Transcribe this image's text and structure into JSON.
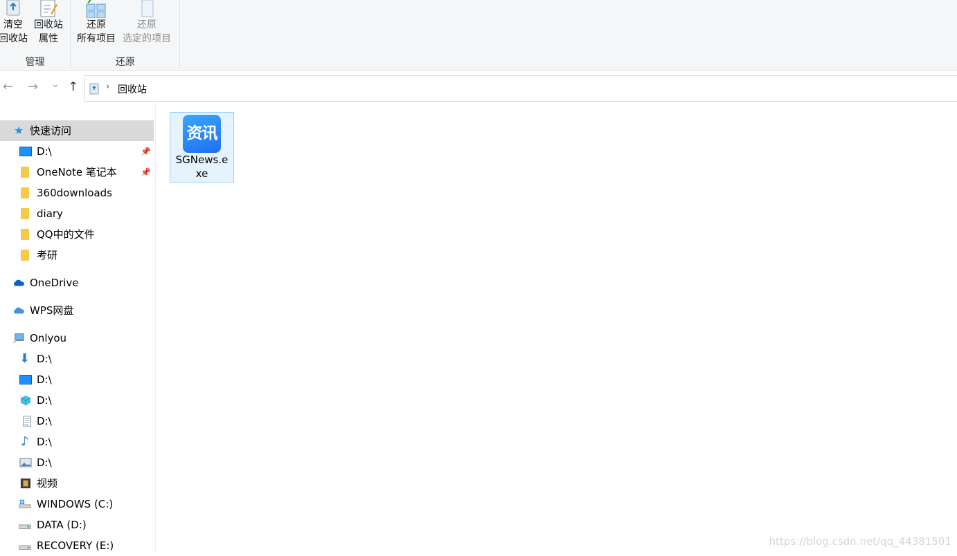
{
  "ribbon": {
    "groups": [
      {
        "label": "管理",
        "buttons": [
          {
            "line1": "清空",
            "line2": "回收站",
            "icon": "recycle-bin-empty-icon"
          },
          {
            "line1": "回收站",
            "line2": "属性",
            "icon": "properties-icon"
          }
        ]
      },
      {
        "label": "还原",
        "buttons": [
          {
            "line1": "还原",
            "line2": "所有项目",
            "icon": "restore-all-icon"
          },
          {
            "line1": "还原",
            "line2": "选定的项目",
            "icon": "restore-selected-icon",
            "disabled": true
          }
        ]
      }
    ]
  },
  "nav": {
    "back": "←",
    "forward": "→",
    "recent": "⌄",
    "up": "↑",
    "chevron": "›",
    "path": "回收站"
  },
  "sidebar": {
    "quick_access": "快速访问",
    "quick_items": [
      "D:\\",
      "OneNote 笔记本",
      "360downloads",
      "diary",
      "QQ中的文件",
      "考研"
    ],
    "onedrive": "OneDrive",
    "wps": "WPS网盘",
    "pc": "Onlyou",
    "pc_items": [
      "D:\\",
      "D:\\",
      "D:\\",
      "D:\\",
      "D:\\",
      "D:\\",
      "视频",
      "WINDOWS (C:)",
      "DATA (D:)",
      "RECOVERY (E:)"
    ],
    "pin_glyph": "📌"
  },
  "content": {
    "file": {
      "name": "SGNews.exe",
      "icon_text": "资讯"
    }
  },
  "watermark": "https://blog.csdn.net/qq_44381501",
  "colors": {
    "accent": "#1d6ff2",
    "selection_bg": "#e5f3ff",
    "selection_border": "#99d1ff"
  }
}
